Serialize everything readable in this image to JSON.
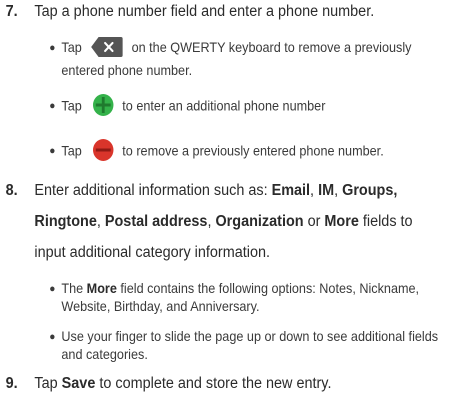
{
  "steps": [
    {
      "number": "7.",
      "text": "Tap a phone number field and enter a phone number.",
      "bullets": [
        {
          "before": "Tap",
          "icon": "delete-key-icon",
          "after": "on the QWERTY keyboard to remove a previously",
          "line2": "entered phone number."
        },
        {
          "before": "Tap",
          "icon": "add-green-icon",
          "after": "to enter an additional phone number"
        },
        {
          "before": "Tap",
          "icon": "remove-red-icon",
          "after": "to remove a previously entered phone number."
        }
      ]
    },
    {
      "number": "8.",
      "line1": {
        "a": "Enter additional information such as: ",
        "email": "Email",
        "c1": ", ",
        "im": "IM",
        "c2": ", ",
        "groups": "Groups,"
      },
      "line2": {
        "ringtone": "Ringtone",
        "c1": ", ",
        "postal": "Postal address",
        "c2": ", ",
        "org": "Organization",
        "or": " or ",
        "more": "More",
        "rest": " fields to"
      },
      "line3": "input additional category information.",
      "bullets": [
        {
          "before": "The ",
          "bold": "More",
          "after": " field contains the following options: Notes, Nickname,",
          "line2": "Website, Birthday, and Anniversary."
        },
        {
          "text": "Use your finger to slide the page up or down to see additional fields",
          "line2": "and categories."
        }
      ]
    },
    {
      "number": "9.",
      "before": "Tap ",
      "bold": "Save",
      "after": " to complete and store the new entry."
    }
  ],
  "colors": {
    "add_green": "#34b24a",
    "remove_red": "#d9352b",
    "key_bg": "#555555"
  }
}
